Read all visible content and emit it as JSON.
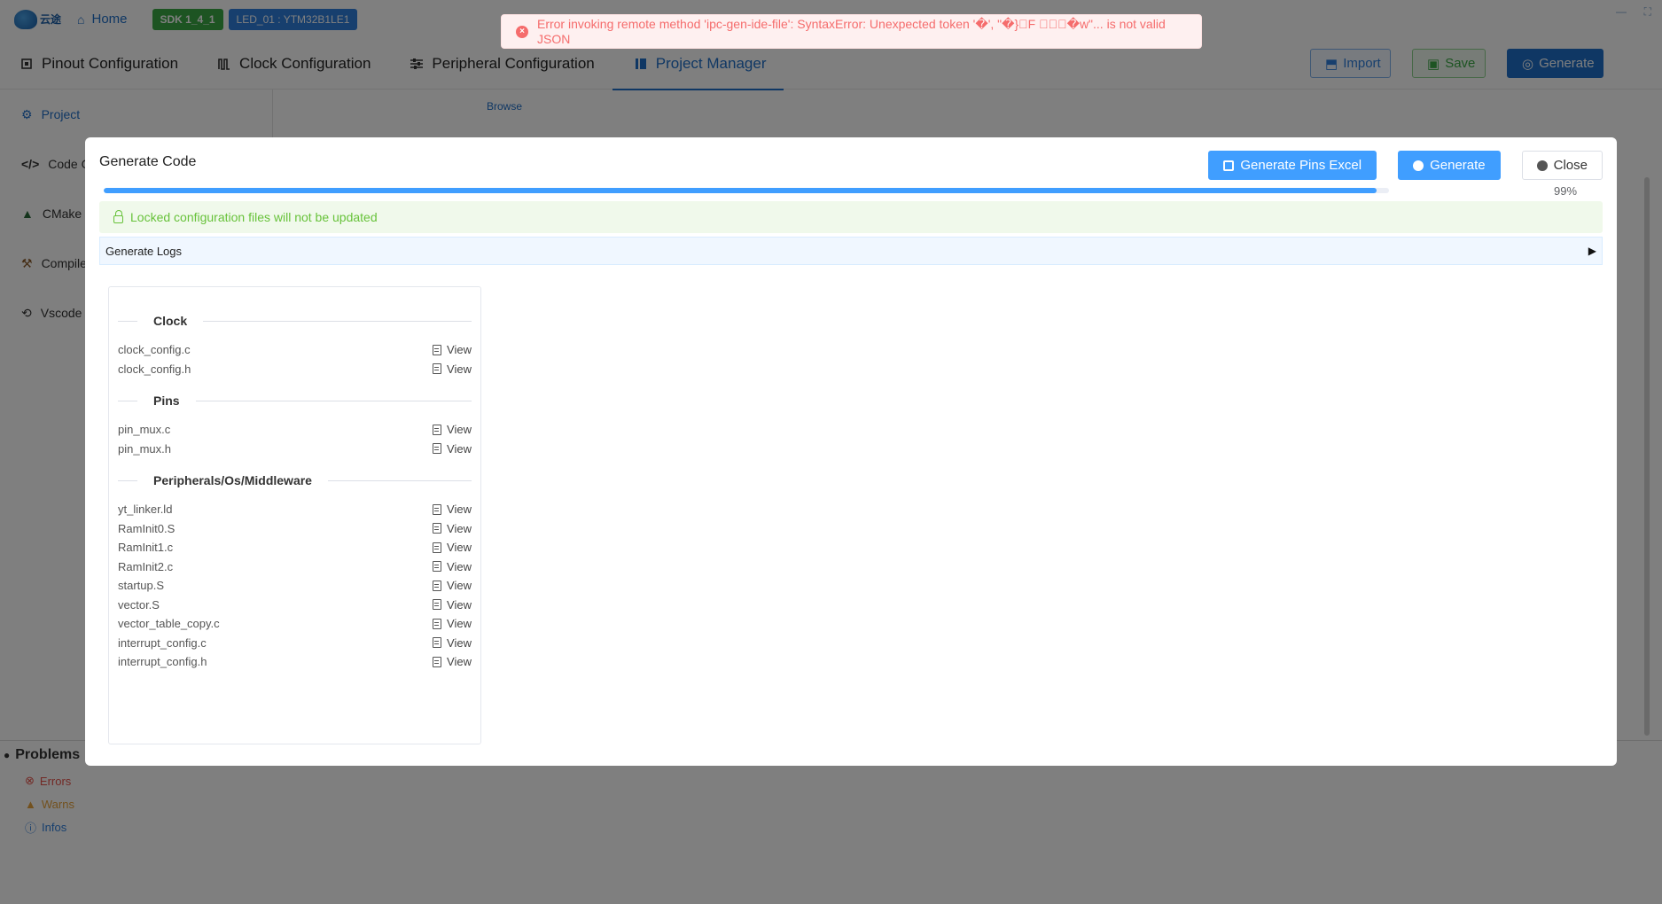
{
  "titlebar": {
    "home_label": "Home",
    "sdk_badge": "SDK 1_4_1",
    "project_badge": "LED_01 : YTM32B1LE1"
  },
  "topnav": {
    "tabs": [
      {
        "label": "Pinout Configuration",
        "icon": "chip-icon"
      },
      {
        "label": "Clock Configuration",
        "icon": "clock-wave-icon"
      },
      {
        "label": "Peripheral Configuration",
        "icon": "sliders-icon"
      },
      {
        "label": "Project Manager",
        "icon": "book-icon",
        "active": true
      }
    ],
    "import_label": "Import",
    "save_label": "Save",
    "generate_label": "Generate"
  },
  "sidenav": {
    "items": [
      {
        "label": "Project",
        "icon": "gear-icon",
        "active": true
      },
      {
        "label": "Code G",
        "icon": "code-icon"
      },
      {
        "label": "CMake",
        "icon": "cmake-icon"
      },
      {
        "label": "Compile",
        "icon": "hammer-icon"
      },
      {
        "label": "Vscode",
        "icon": "vscode-icon"
      }
    ]
  },
  "browse_label": "Browse",
  "problems": {
    "title": "Problems",
    "items": [
      {
        "label": "Errors",
        "color": "#e5534b"
      },
      {
        "label": "Warns",
        "color": "#e6a23c"
      },
      {
        "label": "Infos",
        "color": "#2f7fdc"
      }
    ]
  },
  "toast": {
    "message": "Error invoking remote method 'ipc-gen-ide-file': SyntaxError: Unexpected token '�', \"�}\u0000F \u0000\u0000\u0000�w\"... is not valid JSON"
  },
  "modal": {
    "title": "Generate Code",
    "generate_pins_excel_label": "Generate Pins Excel",
    "generate_label": "Generate",
    "close_label": "Close",
    "progress": 99,
    "progress_label": "99%",
    "notice": "Locked configuration files will not be updated",
    "logs_label": "Generate Logs",
    "view_label": "View",
    "groups": [
      {
        "title": "Clock",
        "files": [
          "clock_config.c",
          "clock_config.h"
        ]
      },
      {
        "title": "Pins",
        "files": [
          "pin_mux.c",
          "pin_mux.h"
        ]
      },
      {
        "title": "Peripherals/Os/Middleware",
        "files": [
          "yt_linker.ld",
          "RamInit0.S",
          "RamInit1.c",
          "RamInit2.c",
          "startup.S",
          "vector.S",
          "vector_table_copy.c",
          "interrupt_config.c",
          "interrupt_config.h"
        ]
      }
    ]
  },
  "colors": {
    "primary": "#409eff",
    "brand_blue": "#1f6fc8",
    "success": "#67c23a",
    "error": "#f56c6c"
  }
}
